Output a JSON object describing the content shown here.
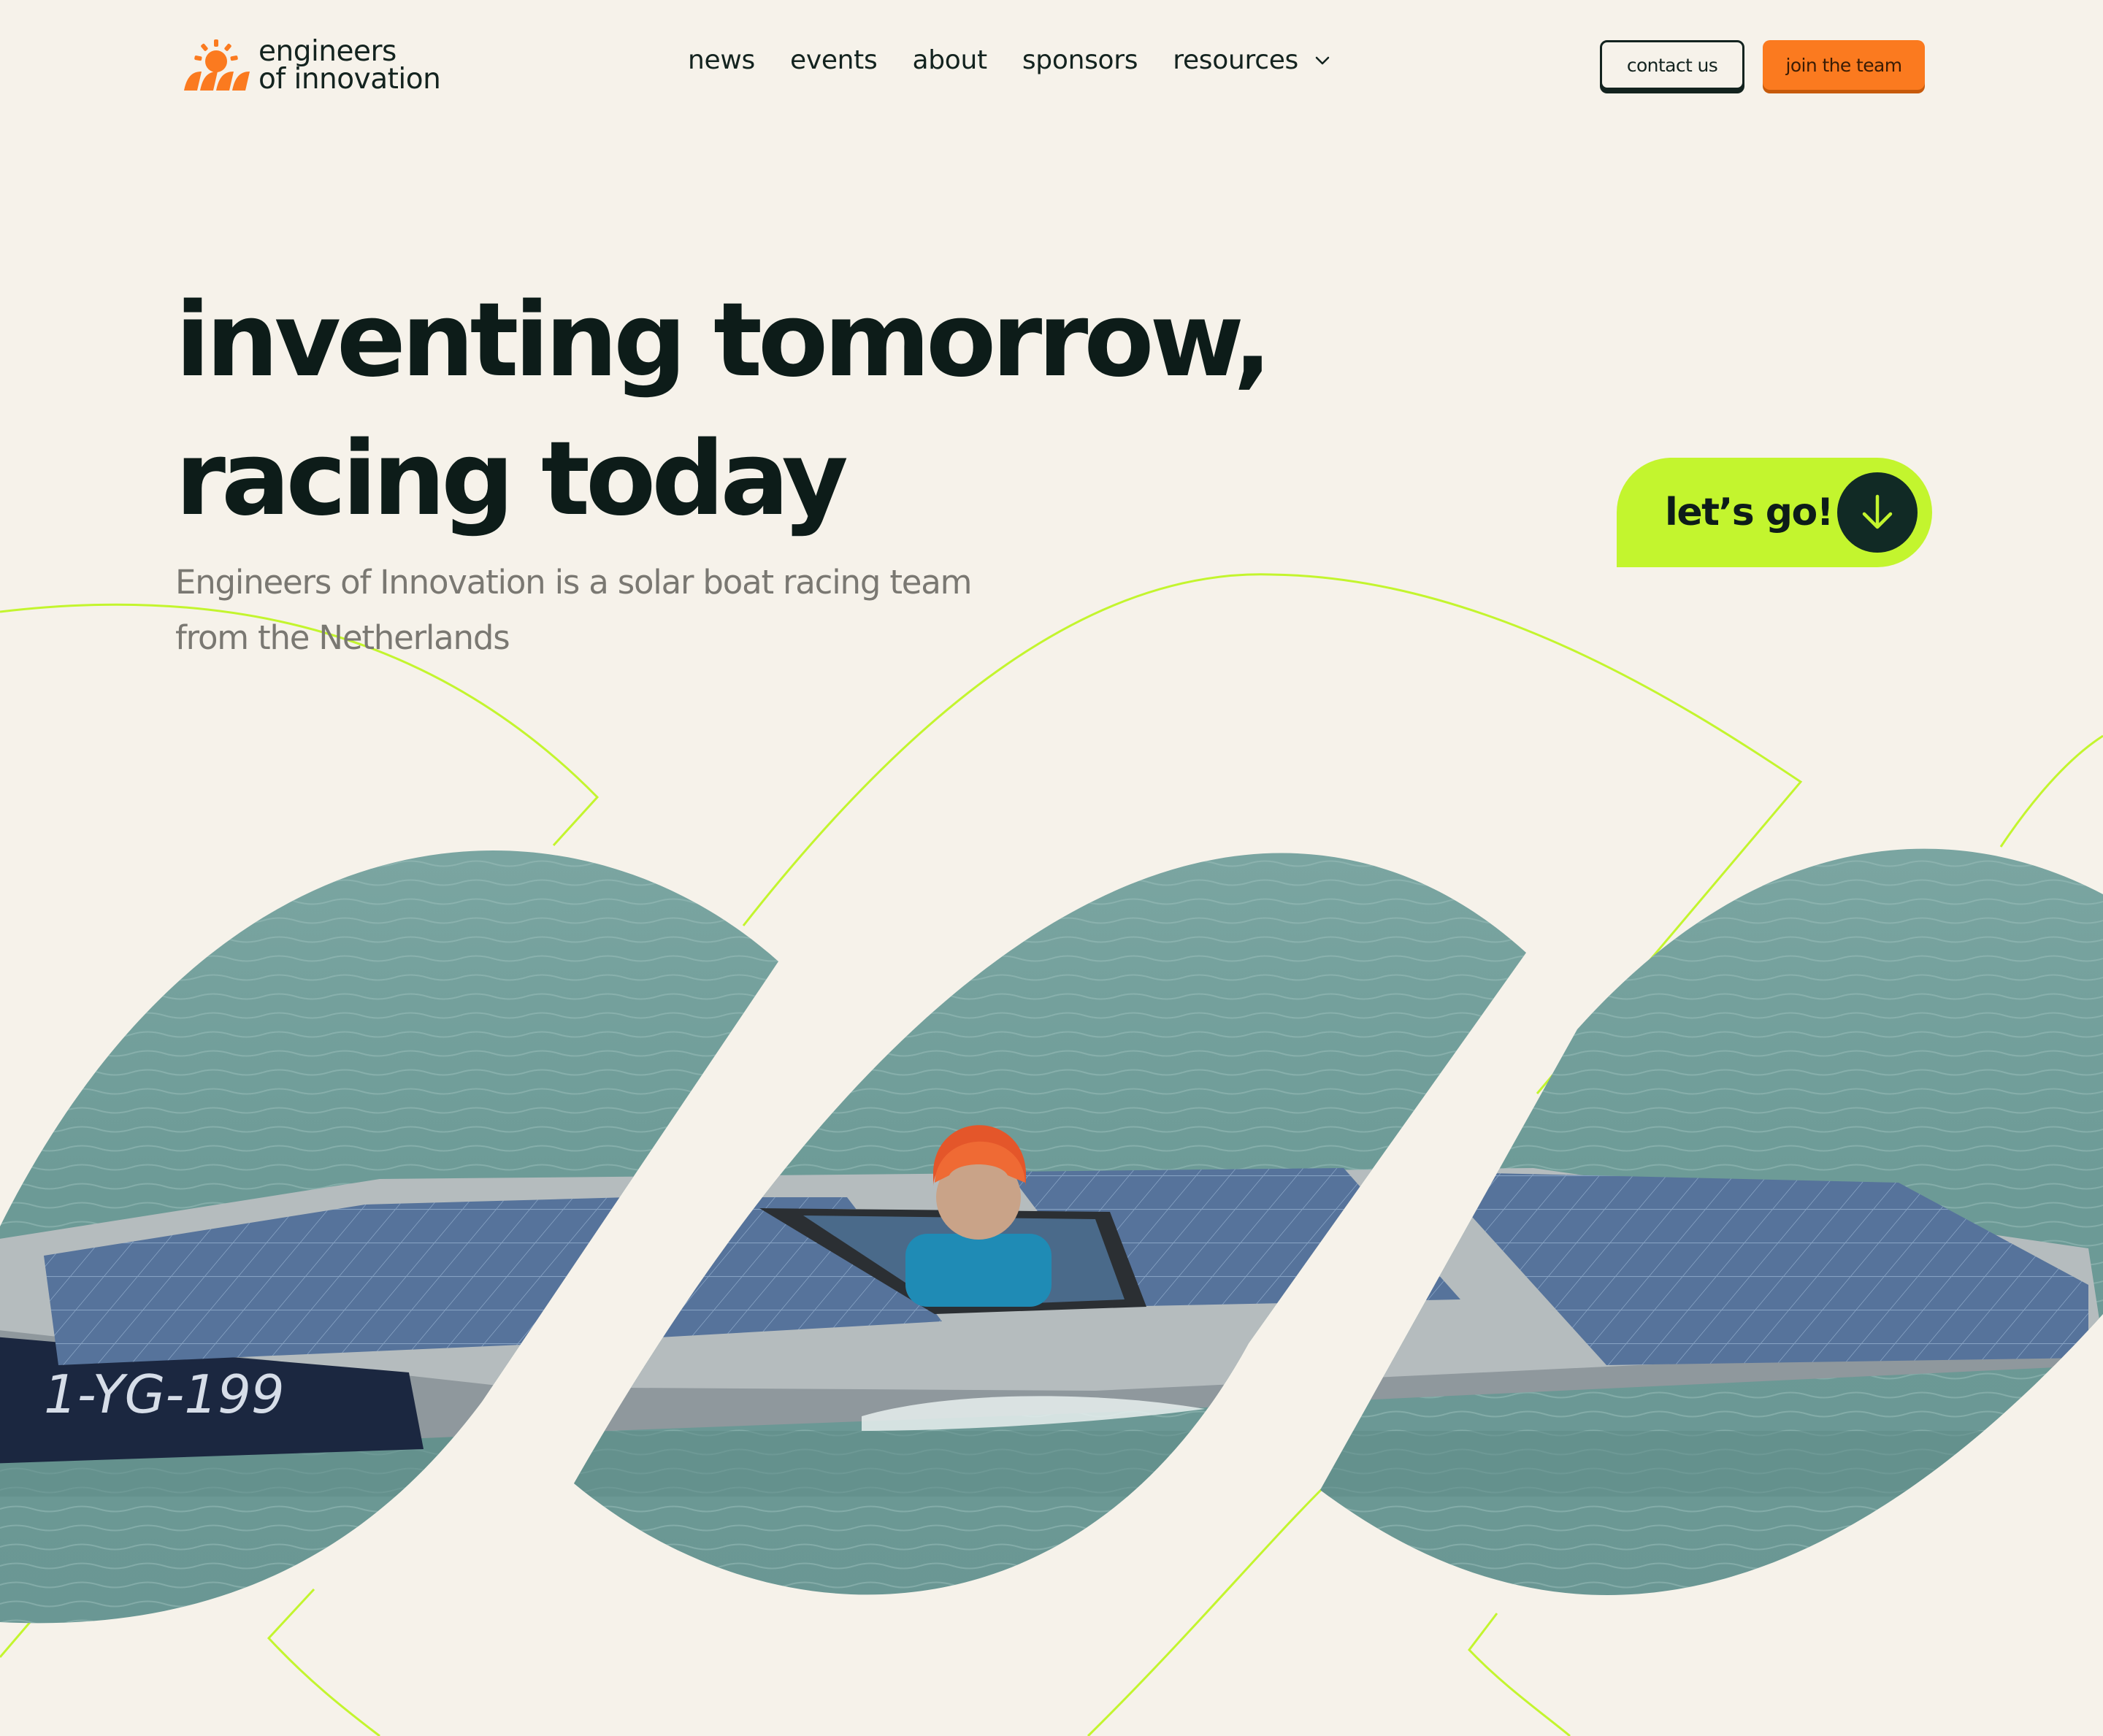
{
  "brand": {
    "name_line1": "engineers",
    "name_line2": "of innovation",
    "accent_color": "#fb7a1f",
    "logo_icon": "sun-waves-logo-icon"
  },
  "nav": {
    "items": [
      {
        "label": "news"
      },
      {
        "label": "events"
      },
      {
        "label": "about"
      },
      {
        "label": "sponsors"
      },
      {
        "label": "resources",
        "icon": "chevron-down-icon"
      }
    ]
  },
  "header_actions": {
    "contact_label": "contact us",
    "join_label": "join the team",
    "join_color": "#fb7a1f"
  },
  "hero": {
    "title_line1": "inventing tomorrow,",
    "title_line2": "racing today",
    "subtitle": "Engineers of Innovation is a solar boat racing team from the Netherlands",
    "cta_label": "let’s go!",
    "cta_icon": "arrow-down-icon",
    "cta_color": "#c3f52e",
    "photo_description_icon": "solar-boat-photo"
  },
  "colors": {
    "background": "#f6f2ea",
    "text_dark": "#0d1c19",
    "text_muted": "#7a7872",
    "outline_lime": "#c3f52e",
    "water": "#6d9a97"
  }
}
